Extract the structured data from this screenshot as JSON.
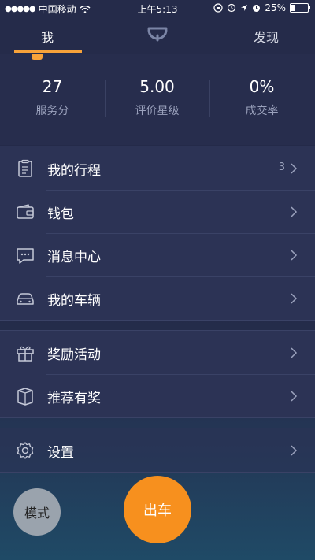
{
  "status_bar": {
    "signal": "●●●●●",
    "carrier": "中国移动",
    "time": "上午5:13",
    "battery_label": "25%",
    "battery_level": 0.25
  },
  "nav": {
    "tab_me": "我",
    "tab_discover": "发现"
  },
  "stats": [
    {
      "value": "27",
      "label": "服务分"
    },
    {
      "value": "5.00",
      "label": "评价星级"
    },
    {
      "value": "0%",
      "label": "成交率"
    }
  ],
  "menu": {
    "group1": [
      {
        "label": "我的行程",
        "count": "3",
        "icon": "clipboard-icon"
      },
      {
        "label": "钱包",
        "icon": "wallet-icon"
      },
      {
        "label": "消息中心",
        "icon": "message-icon"
      },
      {
        "label": "我的车辆",
        "icon": "car-icon"
      }
    ],
    "group2": [
      {
        "label": "奖励活动",
        "icon": "gift-icon"
      },
      {
        "label": "推荐有奖",
        "icon": "box-icon"
      }
    ],
    "group3": [
      {
        "label": "设置",
        "icon": "gear-icon"
      }
    ]
  },
  "buttons": {
    "mode": "模式",
    "go": "出车"
  },
  "colors": {
    "accent": "#f7901e",
    "underline": "#f7a23a",
    "background": "#252b4a"
  }
}
